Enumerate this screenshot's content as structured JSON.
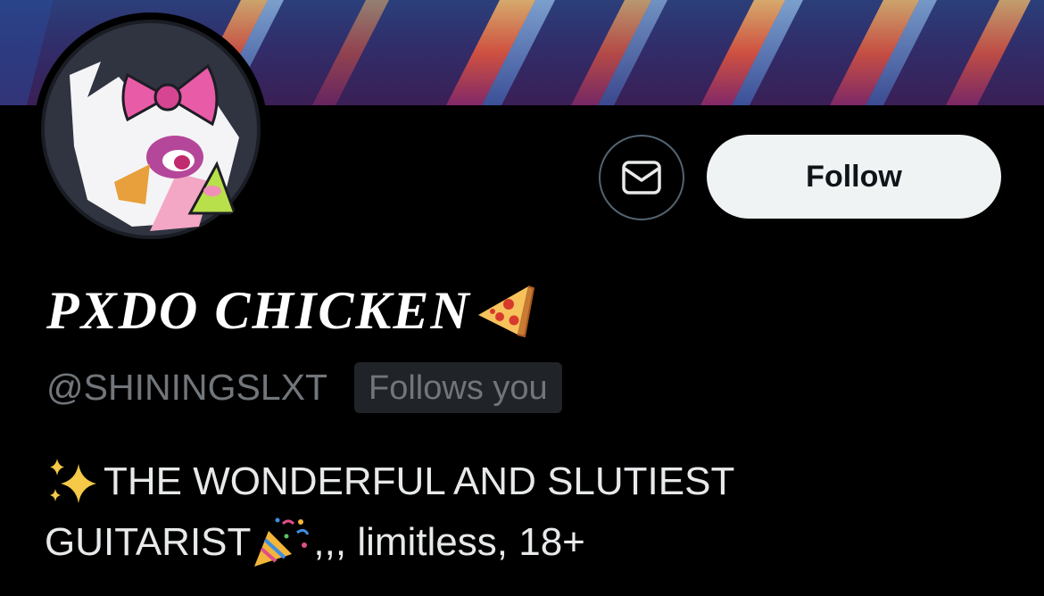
{
  "profile": {
    "display_name": "PXDO CHICKEN",
    "name_emoji": "pizza-emoji",
    "handle": "@SHININGSLXT",
    "follows_you_label": "Follows you",
    "bio_line1": "THE WONDERFUL AND SLUTIEST",
    "bio_line2_a": "GUITARIST",
    "bio_line2_b": ",,, limitless, 18+",
    "bio_emojis": [
      "sparkles-emoji",
      "party-popper-emoji"
    ]
  },
  "actions": {
    "message_icon": "envelope-icon",
    "follow_label": "Follow"
  },
  "colors": {
    "background": "#000000",
    "primary_text": "#e7e9ea",
    "secondary_text": "#71767b",
    "follow_button_bg": "#eff3f4",
    "follow_button_text": "#0f1419",
    "badge_bg": "#202327",
    "border": "#536471"
  }
}
